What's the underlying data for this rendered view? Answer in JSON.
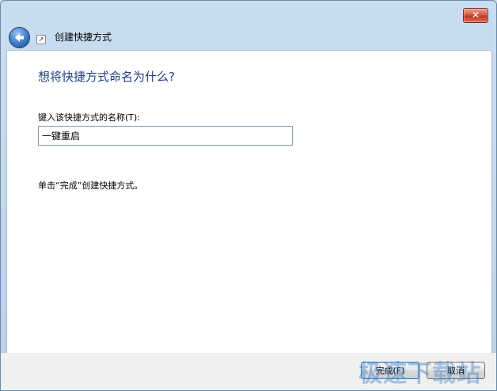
{
  "window": {
    "title": "创建快捷方式",
    "close_label": "✕"
  },
  "content": {
    "heading": "想将快捷方式命名为什么?",
    "name_label": "键入该快捷方式的名称(T):",
    "name_value": "一键重启",
    "hint": "单击“完成”创建快捷方式。"
  },
  "footer": {
    "finish_label": "完成(F)",
    "cancel_label": "取消"
  },
  "watermark": "极速下载站",
  "colors": {
    "heading": "#1e3d86",
    "frame": "#c9ddf1",
    "close": "#c0361f"
  }
}
